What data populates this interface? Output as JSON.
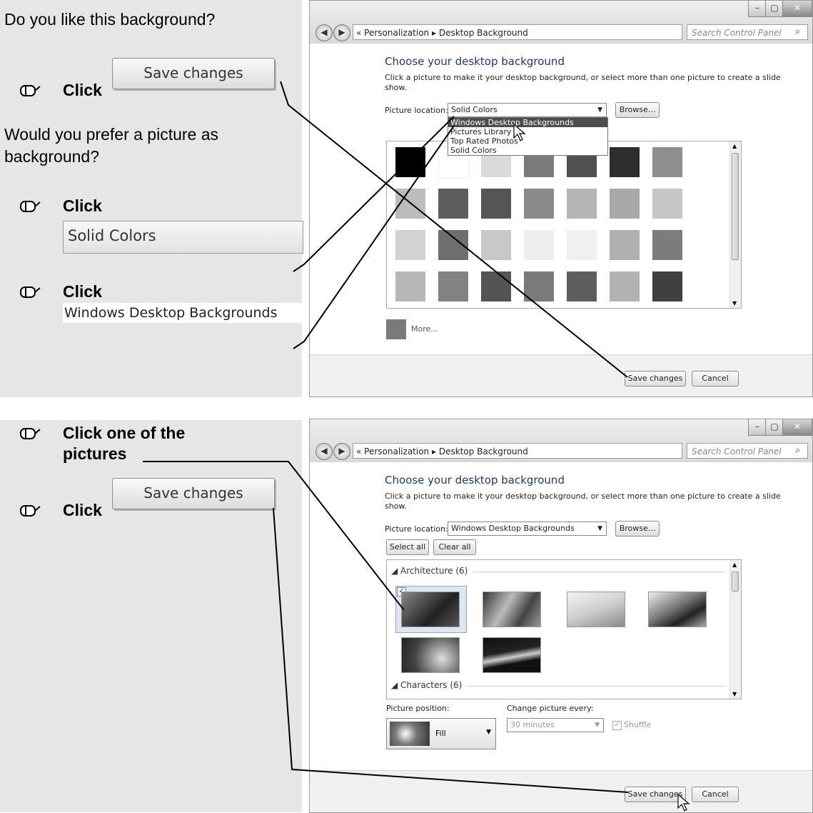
{
  "top": {
    "question1": "Do you like this background?",
    "click_word": "Click",
    "save_callout": "Save changes",
    "question2_line1": "Would you prefer a picture as",
    "question2_line2": "background?",
    "solid_callout": "Solid Colors",
    "wdb_callout": "Windows Desktop Backgrounds"
  },
  "bottom": {
    "step1_line1": "Click one of the",
    "step1_line2": "pictures",
    "click_word": "Click",
    "save_callout": "Save changes"
  },
  "window": {
    "breadcrumb_prefix": "«",
    "breadcrumb_1": "Personalization",
    "breadcrumb_sep": "▸",
    "breadcrumb_2": "Desktop Background",
    "search_placeholder": "Search Control Panel",
    "heading": "Choose your desktop background",
    "description_line1": "Click a picture to make it your desktop background, or select more than one picture to create a slide",
    "description_line2": "show.",
    "picture_location_label": "Picture location:",
    "browse_label": "Browse...",
    "save_changes_label": "Save changes",
    "cancel_label": "Cancel"
  },
  "screen1": {
    "location_value": "Solid Colors",
    "dropdown_options": [
      "Windows Desktop Backgrounds",
      "Pictures Library",
      "Top Rated Photos",
      "Solid Colors"
    ],
    "dropdown_selected_index": 0,
    "more_label": "More...",
    "swatch_colors": [
      [
        "#000000",
        "#ffffff",
        "#d9d9d9",
        "#7a7a7a",
        "#505050",
        "#2e2e2e",
        "#8e8e8e"
      ],
      [
        "#bcbcbc",
        "#5e5e5e",
        "#555555",
        "#8a8a8a",
        "#b5b5b5",
        "#a9a9a9",
        "#c6c6c6"
      ],
      [
        "#d2d2d2",
        "#6e6e6e",
        "#c8c8c8",
        "#eeeeee",
        "#f0f0f0",
        "#b0b0b0",
        "#7c7c7c"
      ],
      [
        "#b6b6b6",
        "#828282",
        "#545454",
        "#7a7a7a",
        "#5e5e5e",
        "#b2b2b2",
        "#404040"
      ]
    ],
    "more_color": "#7a7a7a"
  },
  "screen2": {
    "location_value": "Windows Desktop Backgrounds",
    "select_all_label": "Select all",
    "clear_all_label": "Clear all",
    "category_1": "Architecture (6)",
    "category_2": "Characters (6)",
    "picture_position_label": "Picture position:",
    "picture_position_value": "Fill",
    "change_every_label": "Change picture every:",
    "change_every_value": "30 minutes",
    "shuffle_label": "Shuffle",
    "shuffle_checked": true
  },
  "icons": {
    "mouse": "mouse-icon",
    "back": "back-arrow-icon",
    "forward": "forward-arrow-icon",
    "search": "search-icon",
    "minimize": "minimize-icon",
    "maximize": "maximize-icon",
    "close": "close-icon",
    "cursor": "pointer-cursor-icon"
  }
}
